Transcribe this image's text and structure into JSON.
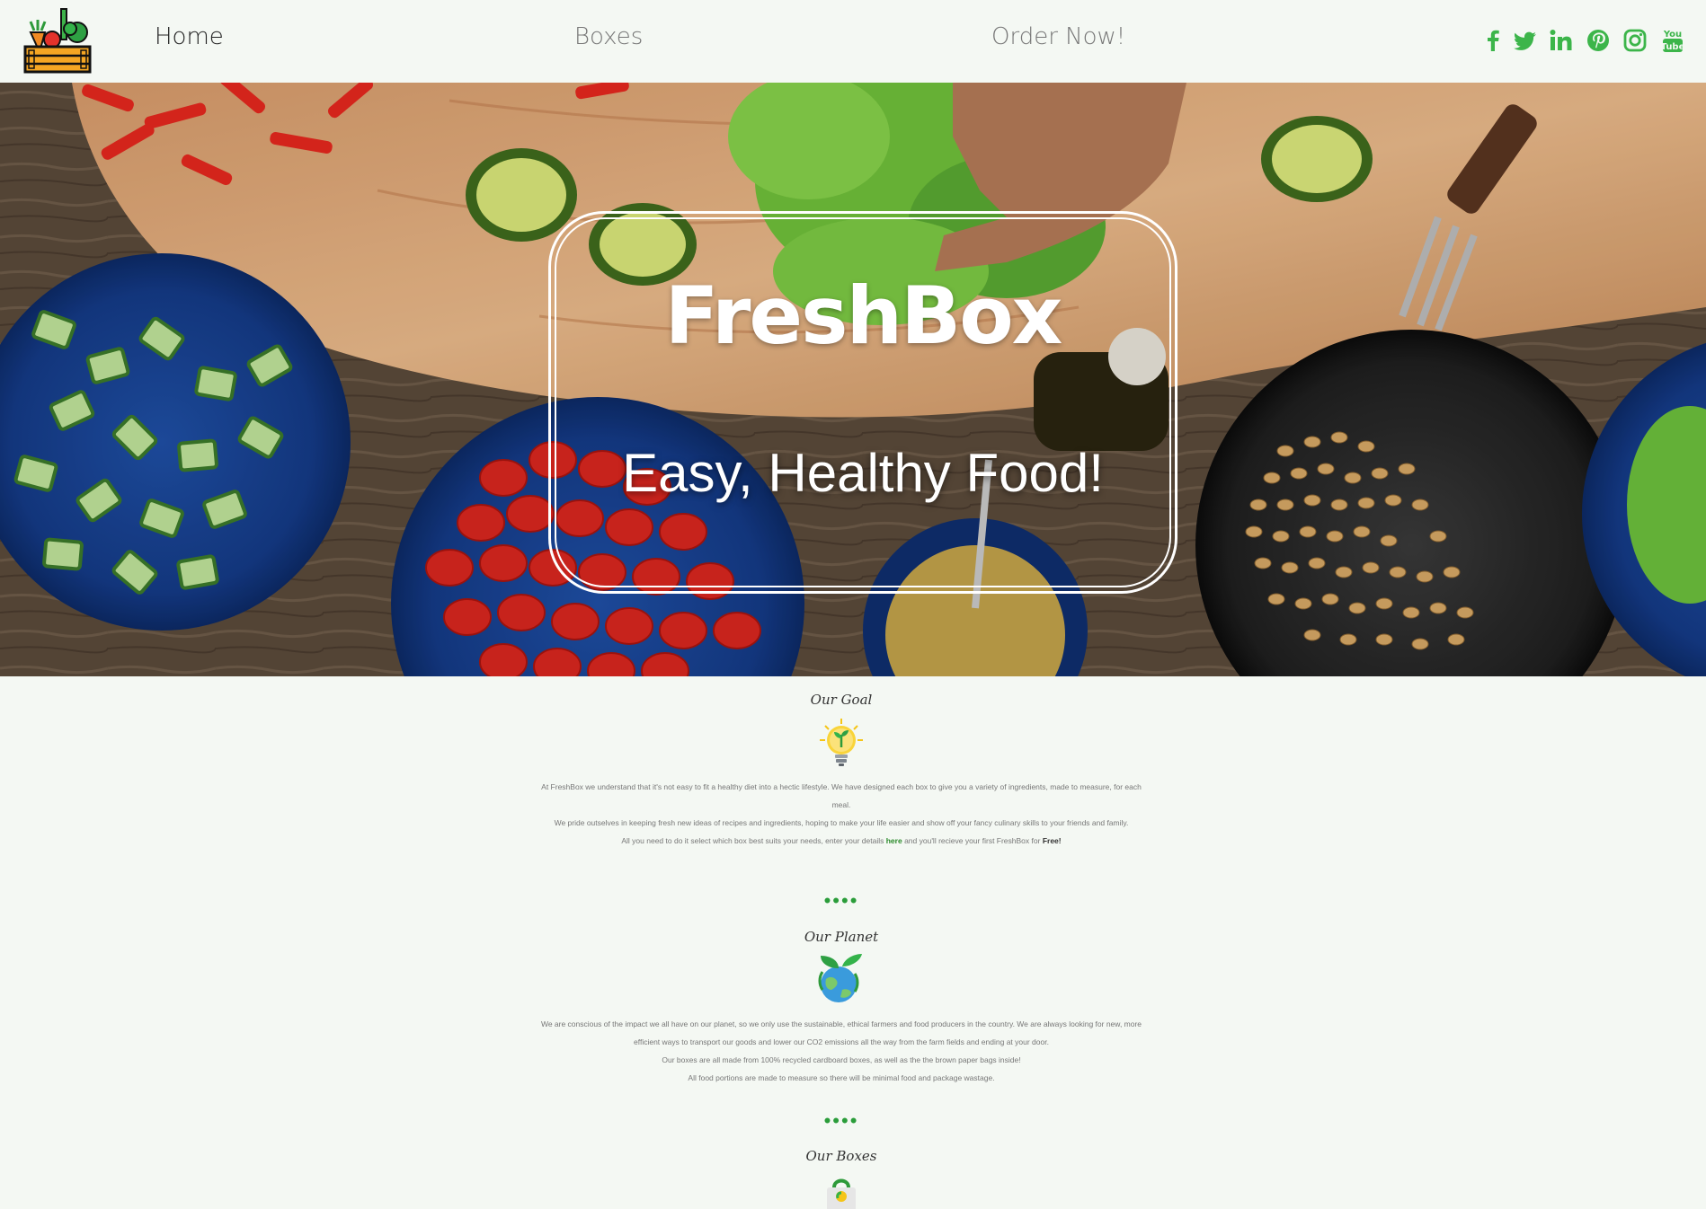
{
  "nav": {
    "home": "Home",
    "boxes": "Boxes",
    "order": "Order Now!"
  },
  "social_icons": [
    "facebook-icon",
    "twitter-icon",
    "linkedin-icon",
    "pinterest-icon",
    "instagram-icon",
    "youtube-icon"
  ],
  "colors": {
    "accent": "#3cb54a",
    "background": "#f4f8f3",
    "link": "#2a8a2a"
  },
  "hero": {
    "title": "FreshBox",
    "subtitle": "Easy, Healthy Food!"
  },
  "goal": {
    "title": "Our Goal",
    "icon": "lightbulb-sprout-icon",
    "p1": "At FreshBox we understand that it's not easy to fit a healthy diet into a hectic lifestyle. We have designed each box to give you a variety of ingredients, made to measure, for each meal.",
    "p2": "We pride outselves in keeping fresh new ideas of recipes and ingredients, hoping to make your life easier and show off your fancy culinary skills to your friends and family.",
    "p3_before": "All you need to do it select which box best suits your needs, enter your details ",
    "p3_link": "here",
    "p3_middle": " and you'll recieve your first FreshBox for ",
    "p3_bold": "Free!"
  },
  "divider": "••••",
  "planet": {
    "title": "Our Planet",
    "icon": "earth-leaf-icon",
    "p1": "We are conscious of the impact we all have on our planet, so we only use the sustainable, ethical farmers and food producers in the country. We are always looking for new, more efficient ways to transport our goods and lower our CO2 emissions all the way from the farm fields and ending at your door.",
    "p2": "Our boxes are all made from 100% recycled cardboard boxes, as well as the the brown paper bags inside!",
    "p3": "All food portions are made to measure so there will be minimal food and package wastage."
  },
  "boxes": {
    "title": "Our Boxes",
    "icon": "shopping-bag-icon"
  }
}
